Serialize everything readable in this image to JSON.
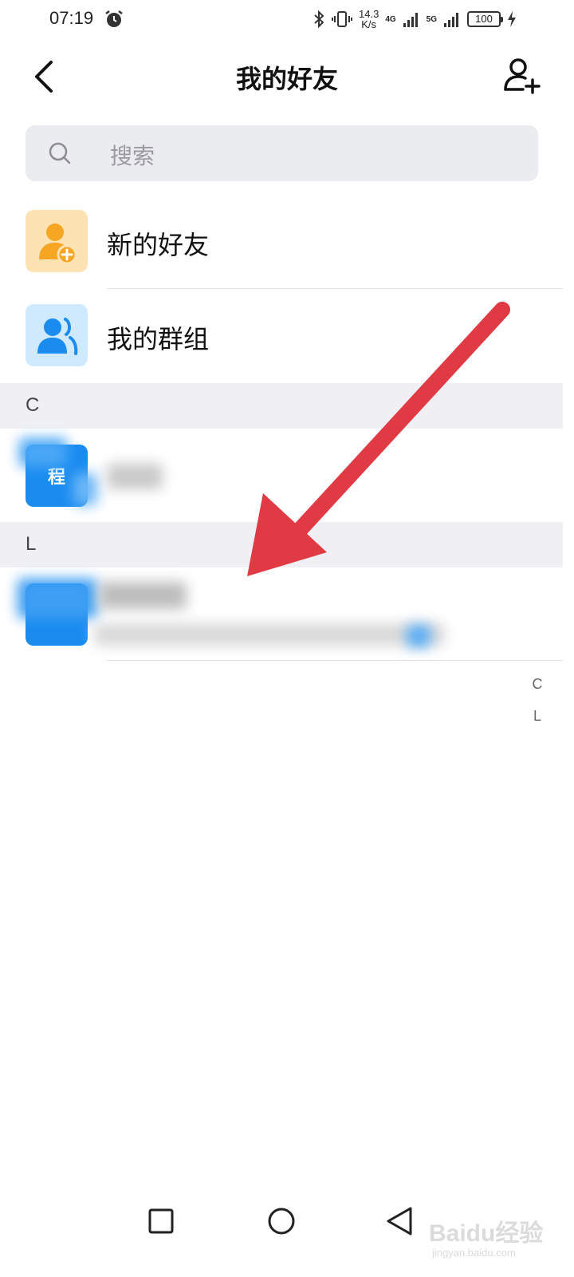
{
  "status_bar": {
    "time": "07:19",
    "net_speed_value": "14.3",
    "net_speed_unit": "K/s",
    "signal1_label": "4G",
    "signal2_label": "5G",
    "battery": "100"
  },
  "header": {
    "title": "我的好友"
  },
  "search": {
    "placeholder": "搜索"
  },
  "menu": {
    "new_friends_label": "新的好友",
    "my_groups_label": "我的群组"
  },
  "sections": [
    {
      "letter": "C",
      "contacts": [
        {
          "avatar_text": "程"
        }
      ]
    },
    {
      "letter": "L",
      "contacts": [
        {
          "avatar_text": ""
        }
      ]
    }
  ],
  "index_bar": [
    "C",
    "L"
  ],
  "colors": {
    "accent_blue": "#1a8cf0",
    "new_friend_bg": "#fde3b4",
    "new_friend_fg": "#f6a623",
    "group_bg": "#cfe9ff",
    "group_fg": "#1a8cf0",
    "arrow": "#e03a45"
  },
  "watermark": {
    "brand": "Baidu经验",
    "url": "jingyan.baidu.com"
  }
}
